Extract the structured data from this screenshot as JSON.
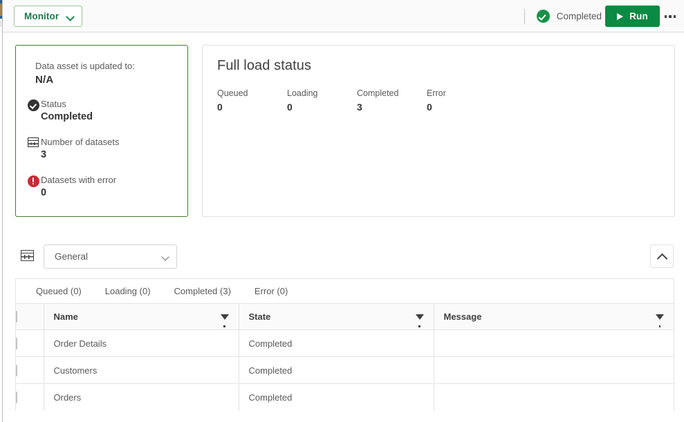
{
  "topbar": {
    "app_menu_label": "Monitor",
    "app_menu_icon": "chevron-down-icon",
    "status_icon": "check-circle-icon",
    "status_text": "Completed",
    "run_label": "Run",
    "run_icon": "play-icon",
    "run_color": "#0a8a42",
    "overflow_icon": "kebab-menu-icon"
  },
  "info_card": {
    "border_color": "#3f7d2e",
    "updated_label": "Data asset is updated to:",
    "updated_value": "N/A",
    "metrics": [
      {
        "icon": "check-circle-icon",
        "label": "Status",
        "value": "Completed"
      },
      {
        "icon": "table-grid-icon",
        "label": "Number of datasets",
        "value": "3"
      },
      {
        "icon": "error-circle-icon",
        "label": "Datasets with error",
        "value": "0"
      }
    ]
  },
  "load_status": {
    "title": "Full load status",
    "counters": [
      {
        "name": "Queued",
        "value": "0"
      },
      {
        "name": "Loading",
        "value": "0"
      },
      {
        "name": "Completed",
        "value": "3"
      },
      {
        "name": "Error",
        "value": "0"
      }
    ]
  },
  "selector": {
    "grid_icon": "table-grid-icon",
    "dropdown_value": "General",
    "dropdown_icon": "chevron-down-icon",
    "collapse_icon": "chevron-up-icon"
  },
  "tabs": [
    {
      "label": "Queued (0)"
    },
    {
      "label": "Loading (0)"
    },
    {
      "label": "Completed (3)"
    },
    {
      "label": "Error (0)"
    }
  ],
  "table": {
    "select_all_icon": "checkbox-icon",
    "filter_icon": "funnel-filter-icon",
    "columns": [
      "Name",
      "State",
      "Message"
    ],
    "rows": [
      {
        "name": "Order Details",
        "state": "Completed",
        "message": ""
      },
      {
        "name": "Customers",
        "state": "Completed",
        "message": ""
      },
      {
        "name": "Orders",
        "state": "Completed",
        "message": ""
      }
    ]
  }
}
